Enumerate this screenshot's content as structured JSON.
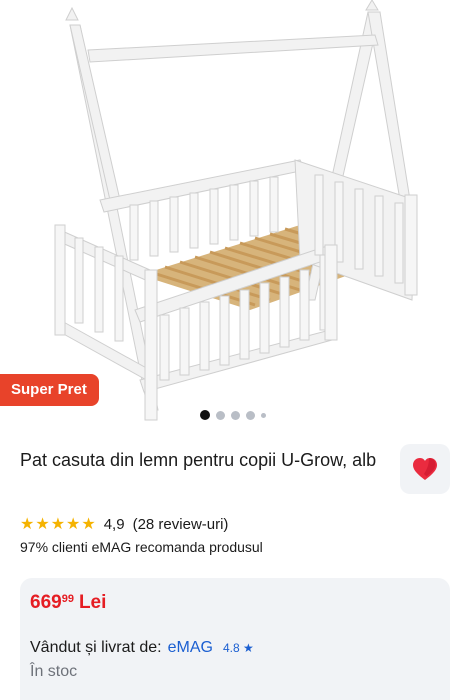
{
  "gallery": {
    "badge": "Super Pret",
    "slide_count": 5,
    "active_slide": 1
  },
  "product": {
    "title": "Pat casuta din lemn pentru copii U-Grow, alb",
    "rating": "4,9",
    "reviews": "(28 review-uri)",
    "stars": 5,
    "recommend": "97% clienti eMAG recomanda produsul"
  },
  "offer": {
    "price_main": "669",
    "price_cents": "99",
    "currency": "Lei",
    "sold_by_label": "Vândut și livrat de:",
    "seller": "eMAG",
    "seller_score": "4.8",
    "stock": "În stoc"
  },
  "colors": {
    "badge": "#e8432a",
    "price": "#e51d23",
    "link": "#1b5fd1",
    "star": "#f5b301",
    "card_bg": "#f1f3f6"
  },
  "icons": [
    "heart-icon",
    "star-icon"
  ]
}
